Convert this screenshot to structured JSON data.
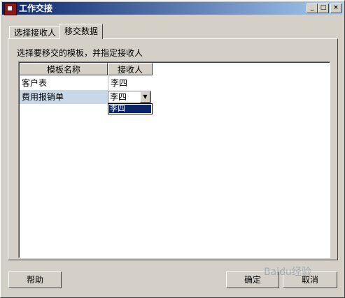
{
  "window": {
    "title": "工作交接",
    "min_glyph": "_",
    "max_glyph": "□",
    "close_glyph": "×"
  },
  "tabs": [
    {
      "label": "选择接收人",
      "active": false
    },
    {
      "label": "移交数据",
      "active": true
    }
  ],
  "panel": {
    "instruction": "选择要移交的模板，并指定接收人"
  },
  "grid": {
    "columns": [
      "模板名称",
      "接收人"
    ],
    "rows": [
      {
        "template": "客户表",
        "receiver": "李四"
      },
      {
        "template": "费用报销单",
        "receiver": "李四"
      }
    ],
    "dropdown_options": [
      "李四"
    ]
  },
  "buttons": {
    "help": "帮助",
    "ok": "确定",
    "cancel": "取消"
  },
  "watermark": "Baidu经验"
}
